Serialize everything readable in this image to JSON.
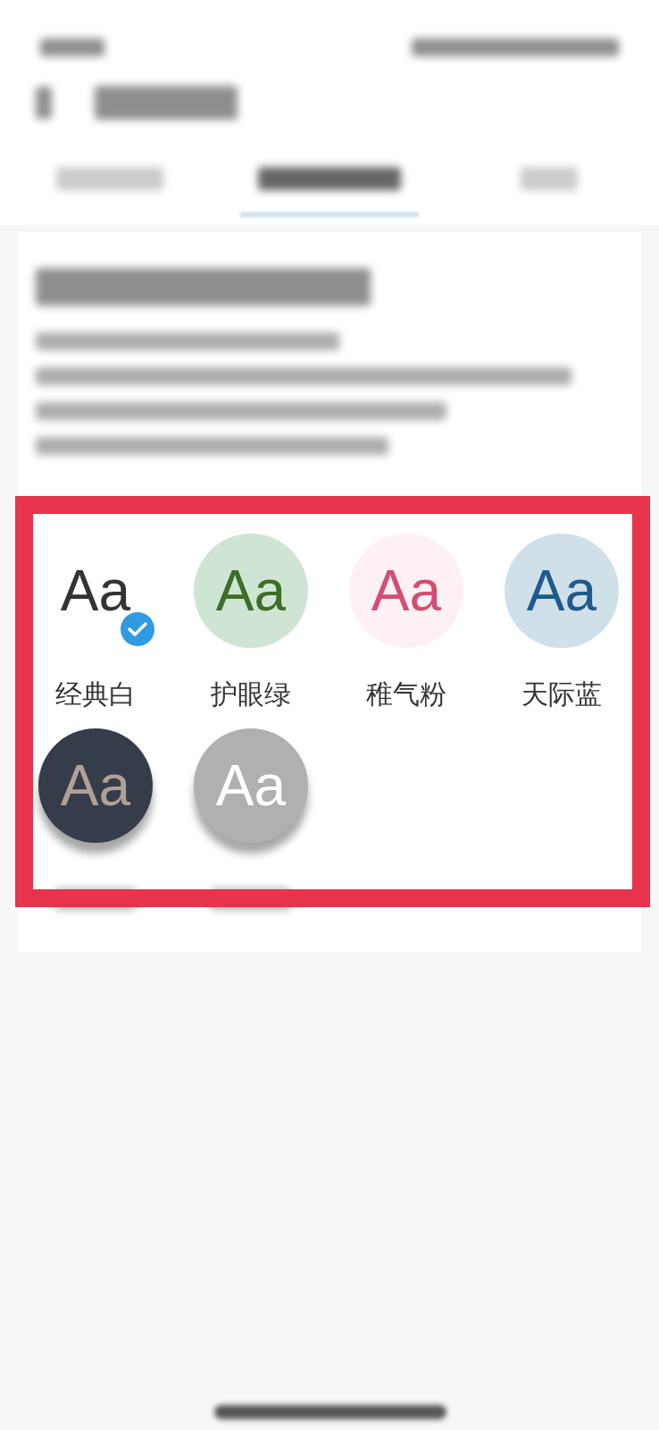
{
  "tabs": [
    {
      "selected": false
    },
    {
      "selected": true
    },
    {
      "selected": false
    }
  ],
  "themes": [
    {
      "label": "经典白",
      "color": "#ffffff",
      "sample": {
        "text": "Aa",
        "color": "#333333"
      },
      "selected": true
    },
    {
      "label": "护眼绿",
      "color": "#cfe5d3",
      "sample": {
        "text": "Aa",
        "color": "#3c6e27"
      },
      "selected": false
    },
    {
      "label": "稚气粉",
      "color": "#fdf1f5",
      "sample": {
        "text": "Aa",
        "color": "#d24e73"
      },
      "selected": false
    },
    {
      "label": "天际蓝",
      "color": "#cfe0e9",
      "sample": {
        "text": "Aa",
        "color": "#1f5a8e"
      },
      "selected": false
    },
    {
      "color": "#353c4a",
      "sample": {
        "text": "Aa",
        "color": "#b0a196"
      },
      "selected": false
    },
    {
      "color": "#b0b0b0",
      "sample": {
        "text": "Aa",
        "color": "#ffffff"
      },
      "selected": false
    }
  ]
}
